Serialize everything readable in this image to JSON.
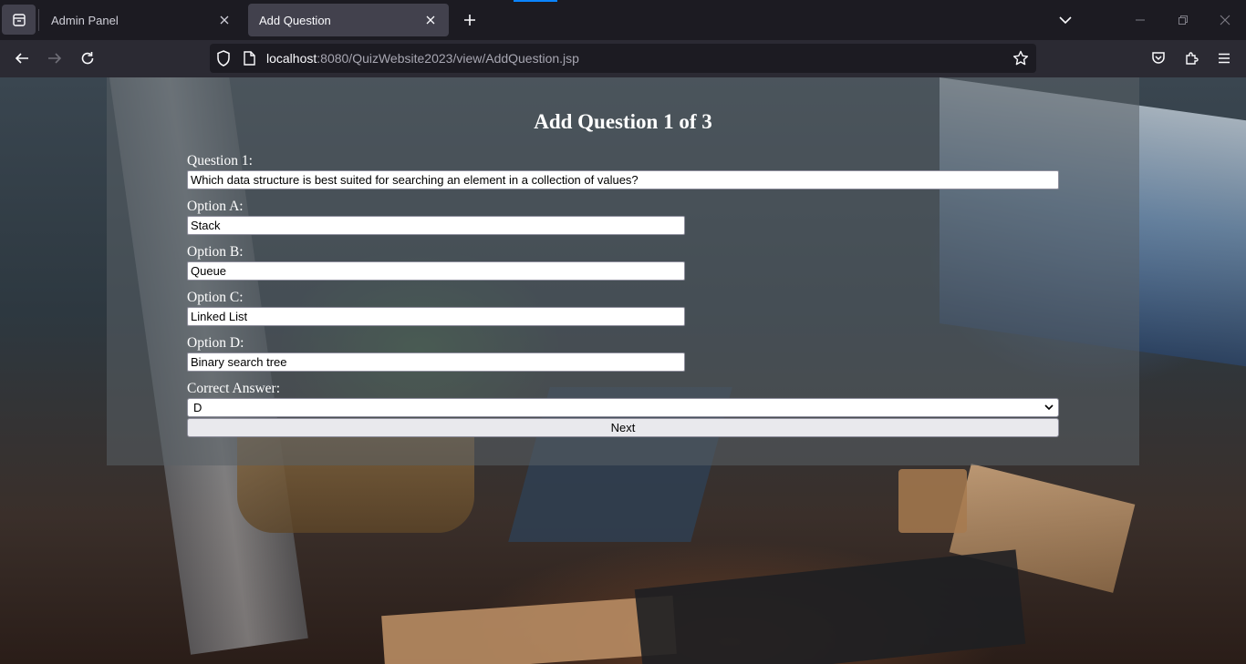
{
  "browser": {
    "tabs": [
      {
        "title": "Admin Panel",
        "active": false
      },
      {
        "title": "Add Question",
        "active": true
      }
    ],
    "url": {
      "host": "localhost",
      "rest": ":8080/QuizWebsite2023/view/AddQuestion.jsp"
    },
    "accent_color": "#0a84ff"
  },
  "form": {
    "title": "Add Question 1 of 3",
    "question_label": "Question 1:",
    "question_value": "Which data structure is best suited for searching an element in a collection of values?",
    "option_a_label": "Option A:",
    "option_a_value": "Stack",
    "option_b_label": "Option B:",
    "option_b_value": "Queue",
    "option_c_label": "Option C:",
    "option_c_value": "Linked List",
    "option_d_label": "Option D:",
    "option_d_value": "Binary search tree",
    "correct_label": "Correct Answer:",
    "correct_value": "D",
    "next_label": "Next"
  }
}
